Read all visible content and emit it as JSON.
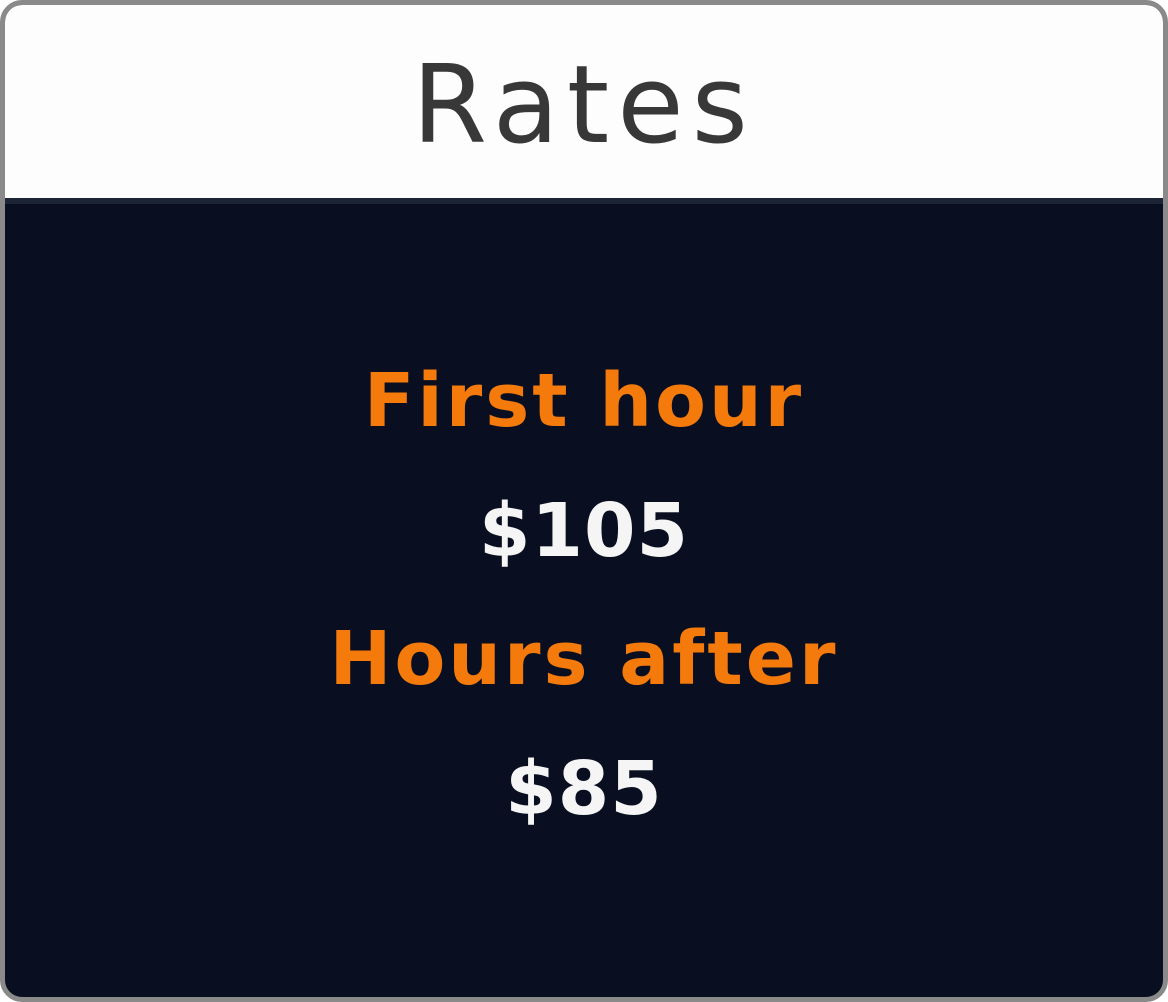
{
  "header": {
    "title": "Rates"
  },
  "rates": [
    {
      "label": "First hour",
      "price": "$105"
    },
    {
      "label": "Hours after",
      "price": "$85"
    }
  ],
  "colors": {
    "header_background": "#fdfdfd",
    "title_text": "#383838",
    "panel_background": "#090f20",
    "label_accent": "#f47a0c",
    "price_text": "#f5f5f5",
    "border": "#8a8a8a"
  }
}
